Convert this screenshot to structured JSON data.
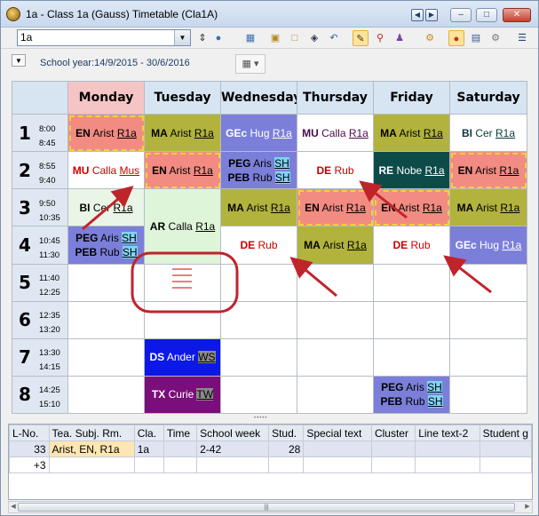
{
  "window": {
    "title": "1a - Class 1a (Gauss)  Timetable  (Cla1A)",
    "min": "–",
    "max": "□",
    "close": "✕"
  },
  "toolbar": {
    "class_value": "1a"
  },
  "subbar": {
    "school_year": "School year:14/9/2015 - 30/6/2016"
  },
  "days": [
    "Monday",
    "Tuesday",
    "Wednesday",
    "Thursday",
    "Friday",
    "Saturday"
  ],
  "periods": [
    {
      "num": "1",
      "start": "8:00",
      "end": "8:45"
    },
    {
      "num": "2",
      "start": "8:55",
      "end": "9:40"
    },
    {
      "num": "3",
      "start": "9:50",
      "end": "10:35"
    },
    {
      "num": "4",
      "start": "10:45",
      "end": "11:30"
    },
    {
      "num": "5",
      "start": "11:40",
      "end": "12:25"
    },
    {
      "num": "6",
      "start": "12:35",
      "end": "13:20"
    },
    {
      "num": "7",
      "start": "13:30",
      "end": "14:15"
    },
    {
      "num": "8",
      "start": "14:25",
      "end": "15:10"
    }
  ],
  "lessons": {
    "p1_mon": {
      "s": "EN",
      "t": "Arist",
      "r": "R1a"
    },
    "p1_tue": {
      "s": "MA",
      "t": "Arist",
      "r": "R1a"
    },
    "p1_wed": {
      "s": "GEc",
      "t": "Hug",
      "r": "R1a"
    },
    "p1_thu": {
      "s": "MU",
      "t": "Calla",
      "r": "R1a"
    },
    "p1_fri": {
      "s": "MA",
      "t": "Arist",
      "r": "R1a"
    },
    "p1_sat": {
      "s": "BI",
      "t": "Cer",
      "r": "R1a"
    },
    "p2_mon": {
      "s": "MU",
      "t": "Calla",
      "r": "Mus"
    },
    "p2_tue": {
      "s": "EN",
      "t": "Arist",
      "r": "R1a"
    },
    "p2_wed_a": {
      "s": "PEG",
      "t": "Aris",
      "r": "SH"
    },
    "p2_wed_b": {
      "s": "PEB",
      "t": "Rub",
      "r": "SH"
    },
    "p2_thu": {
      "s": "DE",
      "t": "Rub"
    },
    "p2_fri": {
      "s": "RE",
      "t": "Nobe",
      "r": "R1a"
    },
    "p2_sat": {
      "s": "EN",
      "t": "Arist",
      "r": "R1a"
    },
    "p3_mon": {
      "s": "BI",
      "t": "Cer",
      "r": "R1a"
    },
    "p3_tue": {
      "s": "AR",
      "t": "Calla",
      "r": "R1a"
    },
    "p3_wed": {
      "s": "MA",
      "t": "Arist",
      "r": "R1a"
    },
    "p3_thu": {
      "s": "EN",
      "t": "Arist",
      "r": "R1a"
    },
    "p3_fri": {
      "s": "EN",
      "t": "Arist",
      "r": "R1a"
    },
    "p3_sat": {
      "s": "MA",
      "t": "Arist",
      "r": "R1a"
    },
    "p4_mon_a": {
      "s": "PEG",
      "t": "Aris",
      "r": "SH"
    },
    "p4_mon_b": {
      "s": "PEB",
      "t": "Rub",
      "r": "SH"
    },
    "p4_wed": {
      "s": "DE",
      "t": "Rub"
    },
    "p4_thu": {
      "s": "MA",
      "t": "Arist",
      "r": "R1a"
    },
    "p4_fri": {
      "s": "DE",
      "t": "Rub"
    },
    "p4_sat": {
      "s": "GEc",
      "t": "Hug",
      "r": "R1a"
    },
    "p7_tue": {
      "s": "DS",
      "t": "Ander",
      "r": "WS"
    },
    "p8_tue": {
      "s": "TX",
      "t": "Curie",
      "r": "TW"
    },
    "p8_fri_a": {
      "s": "PEG",
      "t": "Aris",
      "r": "SH"
    },
    "p8_fri_b": {
      "s": "PEB",
      "t": "Rub",
      "r": "SH"
    }
  },
  "bottom": {
    "headers": [
      "L-No.",
      "Tea. Subj. Rm.",
      "Cla.",
      "Time",
      "School week",
      "Stud.",
      "Special text",
      "Cluster",
      "Line text-2",
      "Student g"
    ],
    "row1": [
      "33",
      "Arist, EN,  R1a",
      "1a",
      "",
      "2-42",
      "28",
      "",
      "",
      "",
      ""
    ],
    "row2": [
      "+3",
      "",
      "",
      "",
      "",
      "",
      "",
      "",
      "",
      ""
    ]
  },
  "icons": [
    "app-icon",
    "nav-back-icon",
    "nav-forward-icon",
    "minimize-icon",
    "maximize-icon",
    "close-icon",
    "dropdown-arrow-icon",
    "spin-icon",
    "group-icon",
    "grid-icon",
    "lock-icon",
    "lock-open-icon",
    "binoculars-icon",
    "undo-icon",
    "pencil-icon",
    "magnifier-icon",
    "people-icon",
    "settings-icon",
    "traffic-light-icon",
    "report-icon",
    "gear-icon",
    "list-icon",
    "calendar-icon",
    "menu-arrow-icon"
  ],
  "colors": {
    "en": "#f28b82",
    "ma": "#b2b33d",
    "gec": "#7b7fd9",
    "re": "#0d4b49",
    "ds": "#0b18e6",
    "tx": "#7a0e7a",
    "annotation": "#c0242b"
  }
}
